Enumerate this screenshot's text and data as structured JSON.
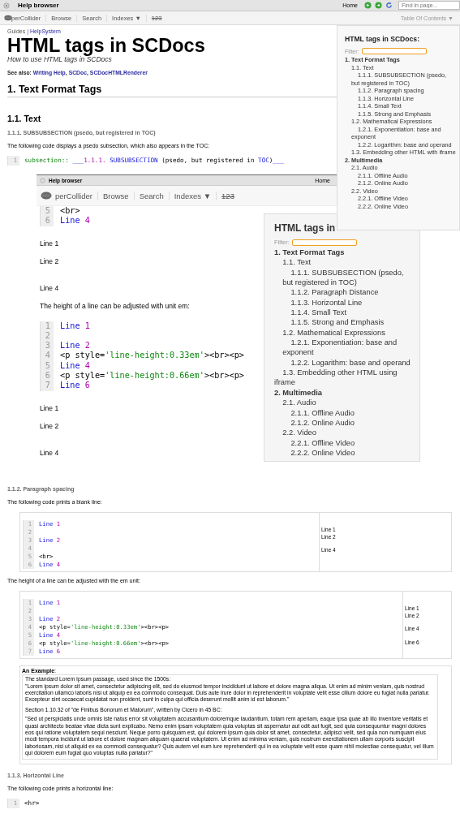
{
  "window": {
    "title": "Help browser",
    "home": "Home",
    "find_placeholder": "Find in page..."
  },
  "toolbar": {
    "logo_text": "perCollider",
    "items": [
      "Browse",
      "Search",
      "Indexes ▼"
    ],
    "numbers": "123",
    "toc_button": "Table Of Contents ▼"
  },
  "breadcrumb": {
    "category": "Guides",
    "separator": "|",
    "link": "HelpSystem"
  },
  "title": "HTML tags in SCDocs",
  "subtitle": "How to use HTML tags in SCDocs",
  "see_also": {
    "label": "See also:",
    "separator": ",",
    "links": [
      "Writing Help",
      "SCDoc",
      "SCDocHTMLRenderer"
    ]
  },
  "section_heading": "1. Text Format Tags",
  "subsection_heading": "1.1. Text",
  "subsubsection": {
    "heading": "1.1.1. SUBSUBSECTION (psedo, but registered in TOC)",
    "description": "The following code displays a psedo subsection, which also appears in the TOC:",
    "code": [
      {
        "num": "1",
        "tokens": [
          {
            "kind": "tag",
            "text": "subsection:: "
          },
          {
            "kind": "keyword",
            "text": "___"
          },
          {
            "kind": "number",
            "text": "1.1.1. "
          },
          {
            "kind": "keyword",
            "text": "SUBSUBSECTION "
          },
          {
            "kind": "plain",
            "text": "(psedo, but registered in "
          },
          {
            "kind": "keyword",
            "text": "TOC"
          },
          {
            "kind": "plain",
            "text": ")"
          },
          {
            "kind": "keyword",
            "text": "___"
          }
        ]
      }
    ]
  },
  "embedded_screenshot": {
    "title": "Help browser",
    "home": "Home",
    "logo_text": "perCollider",
    "toolbar_items": [
      "Browse",
      "Search",
      "Indexes ▼"
    ],
    "numbers": "123",
    "code_top": [
      {
        "num": "5",
        "tokens": [
          {
            "kind": "plain",
            "text": "<br>"
          }
        ]
      },
      {
        "num": "6",
        "tokens": [
          {
            "kind": "keyword",
            "text": "Line "
          },
          {
            "kind": "number",
            "text": "4"
          }
        ]
      }
    ],
    "output_1": [
      {
        "text": "Line 1",
        "blank_before": false
      },
      {
        "text": "Line 2",
        "blank_before": false
      },
      {
        "text": "Line 4",
        "blank_before": true
      }
    ],
    "line_height_text": "The height of a line can be adjusted with unit em:",
    "code": [
      {
        "num": "1",
        "tokens": [
          {
            "kind": "keyword",
            "text": "Line "
          },
          {
            "kind": "number",
            "text": "1"
          }
        ]
      },
      {
        "num": "2"
      },
      {
        "num": "3",
        "tokens": [
          {
            "kind": "keyword",
            "text": "Line "
          },
          {
            "kind": "number",
            "text": "2"
          }
        ]
      },
      {
        "num": "4",
        "tokens": [
          {
            "kind": "plain",
            "text": "<p style="
          },
          {
            "kind": "string",
            "text": "'line-height:0.33em'"
          },
          {
            "kind": "plain",
            "text": "><br><p>"
          }
        ]
      },
      {
        "num": "5",
        "tokens": [
          {
            "kind": "keyword",
            "text": "Line "
          },
          {
            "kind": "number",
            "text": "4"
          }
        ]
      },
      {
        "num": "6",
        "tokens": [
          {
            "kind": "plain",
            "text": "<p style="
          },
          {
            "kind": "string",
            "text": "'line-height:0.66em'"
          },
          {
            "kind": "plain",
            "text": "><br><p>"
          }
        ]
      },
      {
        "num": "7",
        "tokens": [
          {
            "kind": "keyword",
            "text": "Line "
          },
          {
            "kind": "number",
            "text": "6"
          }
        ]
      }
    ],
    "output_2": [
      {
        "text": "Line 1",
        "blank_before": false
      },
      {
        "text": "Line 2",
        "blank_before": false
      },
      {
        "text": "Line 4",
        "blank_before": true
      }
    ],
    "toc": {
      "title": "HTML tags in",
      "filter_label": "Filter:",
      "items": [
        {
          "label": "1. Text Format Tags",
          "children": [
            {
              "label": "1.1. Text",
              "children": [
                {
                  "label": "1.1.1. SUBSUBSECTION (psedo, but registered in TOC)"
                },
                {
                  "label": "1.1.2. Paragraph Distance"
                },
                {
                  "label": "1.1.3. Horizontal Line"
                },
                {
                  "label": "1.1.4. Small Text"
                },
                {
                  "label": "1.1.5. Strong and Emphasis"
                }
              ]
            },
            {
              "label": "1.2. Mathematical Expressions",
              "children": [
                {
                  "label": "1.2.1. Exponentiation: base and exponent"
                },
                {
                  "label": "1.2.2. Logarithm: base and operand"
                }
              ]
            },
            {
              "label": "1.3. Embedding other HTML using iframe"
            }
          ]
        },
        {
          "label": "2. Multimedia",
          "children": [
            {
              "label": "2.1. Audio",
              "children": [
                {
                  "label": "2.1.1. Offline Audio"
                },
                {
                  "label": "2.1.2. Online Audio"
                }
              ]
            },
            {
              "label": "2.2. Video",
              "children": [
                {
                  "label": "2.2.1. Offline Video"
                },
                {
                  "label": "2.2.2. Online Video"
                }
              ]
            }
          ]
        }
      ]
    }
  },
  "paragraph_spacing": {
    "heading": "1.1.2. Paragraph spacing",
    "intro": "The following code prints a blank line:",
    "example_1": {
      "code": [
        {
          "num": "1",
          "tokens": [
            {
              "kind": "keyword",
              "text": "Line "
            },
            {
              "kind": "number",
              "text": "1"
            }
          ]
        },
        {
          "num": "2"
        },
        {
          "num": "3",
          "tokens": [
            {
              "kind": "keyword",
              "text": "Line "
            },
            {
              "kind": "number",
              "text": "2"
            }
          ]
        },
        {
          "num": "4"
        },
        {
          "num": "5",
          "tokens": [
            {
              "kind": "plain",
              "text": "<br>"
            }
          ]
        },
        {
          "num": "6",
          "tokens": [
            {
              "kind": "keyword",
              "text": "Line "
            },
            {
              "kind": "number",
              "text": "4"
            }
          ]
        }
      ],
      "output": [
        {
          "text": "Line 1",
          "blank_before": false
        },
        {
          "text": "Line 2",
          "blank_before": false
        },
        {
          "text": "Line 4",
          "blank_before": true
        }
      ]
    },
    "line_height_text": "The height of a line can be adjusted with the em unit:",
    "example_2": {
      "code": [
        {
          "num": "1",
          "tokens": [
            {
              "kind": "keyword",
              "text": "Line "
            },
            {
              "kind": "number",
              "text": "1"
            }
          ]
        },
        {
          "num": "2"
        },
        {
          "num": "3",
          "tokens": [
            {
              "kind": "keyword",
              "text": "Line "
            },
            {
              "kind": "number",
              "text": "2"
            }
          ]
        },
        {
          "num": "4",
          "tokens": [
            {
              "kind": "plain",
              "text": "<p style="
            },
            {
              "kind": "string",
              "text": "'line-height:0.33em'"
            },
            {
              "kind": "plain",
              "text": "><br><p>"
            }
          ]
        },
        {
          "num": "5",
          "tokens": [
            {
              "kind": "keyword",
              "text": "Line "
            },
            {
              "kind": "number",
              "text": "4"
            }
          ]
        },
        {
          "num": "6",
          "tokens": [
            {
              "kind": "plain",
              "text": "<p style="
            },
            {
              "kind": "string",
              "text": "'line-height:0.66em'"
            },
            {
              "kind": "plain",
              "text": "><br><p>"
            }
          ]
        },
        {
          "num": "7",
          "tokens": [
            {
              "kind": "keyword",
              "text": "Line "
            },
            {
              "kind": "number",
              "text": "6"
            }
          ]
        }
      ],
      "output": [
        {
          "text": "Line 1",
          "blank_before": false
        },
        {
          "text": "Line 2",
          "blank_before": false
        },
        {
          "text": "Line 4",
          "blank_before": true
        },
        {
          "text": "Line 6",
          "blank_before": true
        }
      ]
    },
    "example_box": {
      "label": "**An Example**:",
      "paragraphs": [
        {
          "kind": "lead",
          "text": "The standard Lorem Ipsum passage, used since the 1500s:"
        },
        {
          "kind": "quote",
          "text": "\"Lorem ipsum dolor sit amet, consectetur adipiscing elit, sed do eiusmod tempor incididunt ut labore et dolore magna aliqua. Ut enim ad minim veniam, quis nostrud exercitation ullamco laboris nisi ut aliquip ex ea commodo consequat. Duis aute irure dolor in reprehenderit in voluptate velit esse cillum dolore eu fugiat nulla pariatur. Excepteur sint occaecat cupidatat non proident, sunt in culpa qui officia deserunt mollit anim id est laborum.\""
        },
        {
          "kind": "lead",
          "text": "Section 1.10.32 of \"de Finibus Bonorum et Malorum\", written by Cicero in 45 BC:"
        },
        {
          "kind": "quote",
          "text": "\"Sed ut perspiciatis unde omnis iste natus error sit voluptatem accusantium doloremque laudantium, totam rem aperiam, eaque ipsa quae ab illo inventore veritatis et quasi architecto beatae vitae dicta sunt explicabo. Nemo enim ipsam voluptatem quia voluptas sit aspernatur aut odit aut fugit, sed quia consequuntur magni dolores eos qui ratione voluptatem sequi nesciunt. Neque porro quisquam est, qui dolorem ipsum quia dolor sit amet, consectetur, adipisci velit, sed quia non numquam eius modi tempora incidunt ut labore et dolore magnam aliquam quaerat voluptatem. Ut enim ad minima veniam, quis nostrum exercitationem ullam corporis suscipit laboriosam, nisi ut aliquid ex ea commodi consequatur? Quis autem vel eum iure reprehenderit qui in ea voluptate velit esse quam nihil molestiae consequatur, vel illum qui dolorem eum fugiat quo voluptas nulla pariatur?\""
        }
      ]
    }
  },
  "horizontal_line": {
    "heading": "1.1.3. Horizontal Line",
    "intro": "The following code prints a horizontal line:",
    "code": [
      {
        "num": "1",
        "tokens": [
          {
            "kind": "plain",
            "text": "<hr>"
          }
        ]
      }
    ]
  },
  "toc": {
    "title": "HTML tags in SCDocs:",
    "filter_label": "Filter:",
    "items": [
      {
        "label": "1. Text Format Tags",
        "children": [
          {
            "label": "1.1. Text",
            "children": [
              {
                "label": "1.1.1. SUBSUBSECTION (psedo, but registered in TOC)"
              },
              {
                "label": "1.1.2. Paragraph spacing"
              },
              {
                "label": "1.1.3. Horizontal Line"
              },
              {
                "label": "1.1.4. Small Text"
              },
              {
                "label": "1.1.5. Strong and Emphasis"
              }
            ]
          },
          {
            "label": "1.2. Mathematical Expressions",
            "children": [
              {
                "label": "1.2.1. Exponentiation: base and exponent"
              },
              {
                "label": "1.2.2. Logarithm: base and operand"
              }
            ]
          },
          {
            "label": "1.3. Embedding other HTML with iframe"
          }
        ]
      },
      {
        "label": "2. Multimedia",
        "children": [
          {
            "label": "2.1. Audio",
            "children": [
              {
                "label": "2.1.1. Offline Audio"
              },
              {
                "label": "2.1.2. Online Audio"
              }
            ]
          },
          {
            "label": "2.2. Video",
            "children": [
              {
                "label": "2.2.1. Offline Video"
              },
              {
                "label": "2.2.2. Online Video"
              }
            ]
          }
        ]
      }
    ]
  }
}
